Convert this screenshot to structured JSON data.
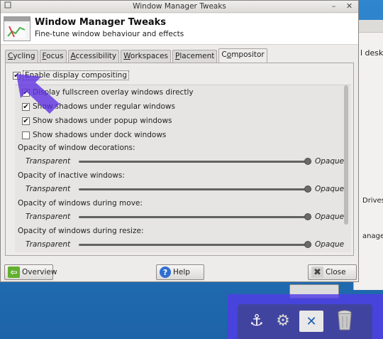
{
  "window": {
    "title": "Window Manager Tweaks",
    "header_title": "Window Manager Tweaks",
    "header_subtitle": "Fine-tune window behaviour and effects"
  },
  "tabs": [
    {
      "pre": "",
      "ul": "C",
      "post": "ycling"
    },
    {
      "pre": "",
      "ul": "F",
      "post": "ocus"
    },
    {
      "pre": "",
      "ul": "A",
      "post": "ccessibility"
    },
    {
      "pre": "",
      "ul": "W",
      "post": "orkspaces"
    },
    {
      "pre": "",
      "ul": "P",
      "post": "lacement"
    },
    {
      "pre": "C",
      "ul": "o",
      "post": "mpositor"
    }
  ],
  "compositor": {
    "enable_label": "Enable display compositing",
    "enable_checked": true,
    "options": [
      {
        "label": "Display fullscreen overlay windows directly",
        "checked": true
      },
      {
        "label": "Show shadows under regular windows",
        "checked": true
      },
      {
        "label": "Show shadows under popup windows",
        "checked": true
      },
      {
        "label": "Show shadows under dock windows",
        "checked": false
      }
    ],
    "sliders": [
      {
        "label": "Opacity of window decorations:",
        "min": "Transparent",
        "max": "Opaque",
        "value_percent": 100
      },
      {
        "label": "Opacity of inactive windows:",
        "min": "Transparent",
        "max": "Opaque",
        "value_percent": 100
      },
      {
        "label": "Opacity of windows during move:",
        "min": "Transparent",
        "max": "Opaque",
        "value_percent": 100
      },
      {
        "label": "Opacity of windows during resize:",
        "min": "Transparent",
        "max": "Opaque",
        "value_percent": 100
      }
    ]
  },
  "buttons": {
    "overview": "Overview",
    "help": "Help",
    "close": "Close"
  },
  "background_window": {
    "text1": "l desktop",
    "text2": "Drives",
    "text3": "anager"
  },
  "colors": {
    "accent_arrow": "#5b2de0",
    "desktop_blue": "#2a7ac0",
    "window_bg": "#edeceb"
  },
  "icons": {
    "app": "window-manager-tweaks-icon",
    "overview": "arrow-left-icon",
    "help": "help-icon",
    "close": "close-x-icon",
    "dock": [
      "anchor-icon",
      "gear-icon",
      "settings-tools-icon",
      "trash-icon"
    ]
  }
}
